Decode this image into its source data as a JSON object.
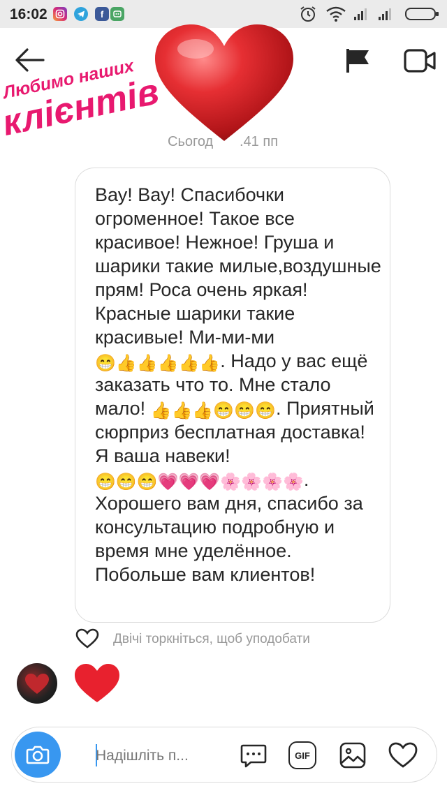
{
  "status_bar": {
    "time": "16:02"
  },
  "overlay": {
    "line1": "Любимо наших",
    "line2": "клієнтів",
    "timestamp_fragment_left": "Сьогод",
    "timestamp_fragment_right": ".41 пп"
  },
  "message": {
    "t1": "Вау! Вау! Спасибочки огроменное! Такое все красивое! Нежное! Груша и шарики такие милые,воздушные прям! Роса очень яркая! Красные шарики такие красивые! Ми-ми-ми ",
    "t2": ". Надо у вас ещё заказать что то. Мне стало мало! ",
    "t3": ". Приятный сюрприз бесплатная доставка! Я ваша навеки! ",
    "t4": ". Хорошего вам дня, спасибо за консультацию подробную и время мне уделённое. Побольше вам клиентов!"
  },
  "like_hint": "Двічі торкніться, щоб уподобати",
  "composer": {
    "placeholder": "Надішліть п...",
    "gif_label": "GIF"
  },
  "colors": {
    "accent": "#3897f0",
    "heart": "#e8212e",
    "overlay_text": "#e8196f"
  }
}
